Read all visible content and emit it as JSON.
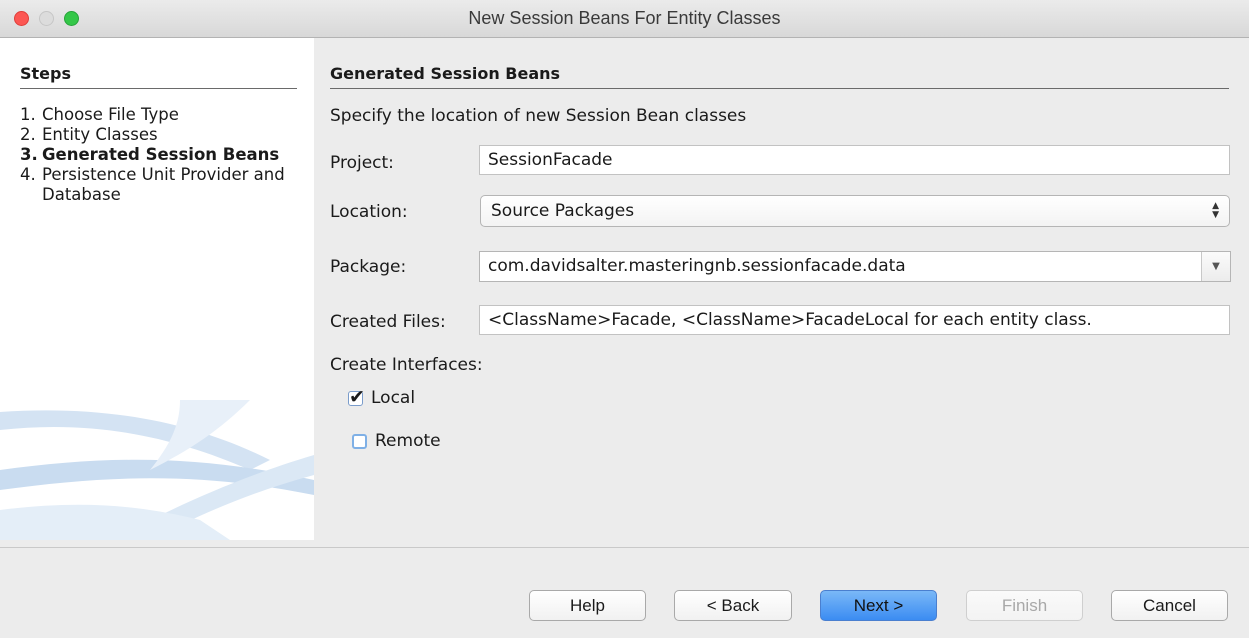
{
  "window": {
    "title": "New Session Beans For Entity Classes"
  },
  "steps": {
    "title": "Steps",
    "items": [
      {
        "num": "1.",
        "label": "Choose File Type"
      },
      {
        "num": "2.",
        "label": "Entity Classes"
      },
      {
        "num": "3.",
        "label": "Generated Session Beans",
        "current": true
      },
      {
        "num": "4.",
        "label": "Persistence Unit Provider and Database"
      }
    ]
  },
  "panel": {
    "title": "Generated Session Beans",
    "description": "Specify the location of new Session Bean classes",
    "project_label": "Project:",
    "project_value": "SessionFacade",
    "location_label": "Location:",
    "location_value": "Source Packages",
    "package_label": "Package:",
    "package_value": "com.davidsalter.masteringnb.sessionfacade.data",
    "created_files_label": "Created Files:",
    "created_files_value": "<ClassName>Facade, <ClassName>FacadeLocal for each entity class.",
    "create_interfaces_label": "Create Interfaces:",
    "local_label": "Local",
    "local_checked": true,
    "remote_label": "Remote",
    "remote_checked": false
  },
  "buttons": {
    "help": "Help",
    "back": "< Back",
    "next": "Next >",
    "finish": "Finish",
    "cancel": "Cancel"
  }
}
